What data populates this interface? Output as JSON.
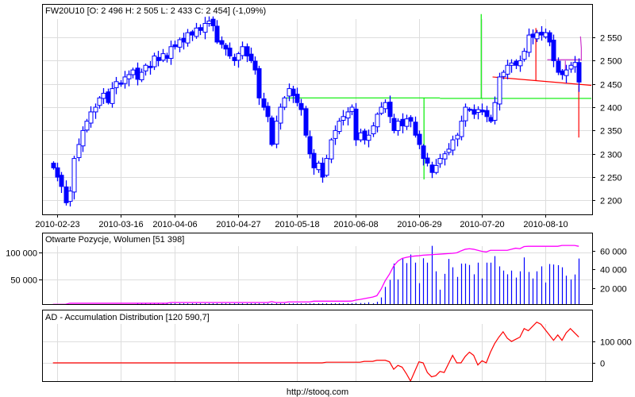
{
  "footer": "http://stooq.com",
  "colors": {
    "candle": "#0000ff",
    "grid": "#dddddd",
    "open_interest": "#ff00ff",
    "volume": "#0000ff",
    "ad": "#ff0000",
    "trend_green": "#00ee00",
    "trend_red": "#ff0000",
    "trend_magenta": "#cc33cc"
  },
  "chart_data": [
    {
      "type": "candlestick",
      "title": "FW20U10 [O: 2 496  H: 2 505  L: 2 433  C: 2 454] (-1,09%)",
      "last_ohlc": {
        "open": 2496,
        "high": 2505,
        "low": 2433,
        "close": 2454,
        "change_pct": -1.09
      },
      "x_ticks": [
        {
          "index": 1,
          "label": "2010-02-23"
        },
        {
          "index": 16,
          "label": "2010-03-16"
        },
        {
          "index": 29,
          "label": "2010-04-06"
        },
        {
          "index": 44,
          "label": "2010-04-27"
        },
        {
          "index": 58,
          "label": "2010-05-18"
        },
        {
          "index": 72,
          "label": "2010-06-08"
        },
        {
          "index": 87,
          "label": "2010-06-29"
        },
        {
          "index": 102,
          "label": "2010-07-20"
        },
        {
          "index": 117,
          "label": "2010-08-10"
        }
      ],
      "y_ticks": [
        {
          "v": 2200,
          "label": "2 200"
        },
        {
          "v": 2250,
          "label": "2 250"
        },
        {
          "v": 2300,
          "label": "2 300"
        },
        {
          "v": 2350,
          "label": "2 350"
        },
        {
          "v": 2400,
          "label": "2 400"
        },
        {
          "v": 2450,
          "label": "2 450"
        },
        {
          "v": 2500,
          "label": "2 500"
        },
        {
          "v": 2550,
          "label": "2 550"
        }
      ],
      "ylim": [
        2170,
        2620
      ],
      "close": [
        2270,
        2250,
        2230,
        2195,
        2220,
        2290,
        2320,
        2350,
        2370,
        2390,
        2400,
        2420,
        2430,
        2410,
        2440,
        2455,
        2450,
        2465,
        2470,
        2480,
        2460,
        2475,
        2490,
        2485,
        2510,
        2500,
        2515,
        2505,
        2530,
        2530,
        2545,
        2540,
        2560,
        2555,
        2570,
        2565,
        2580,
        2585,
        2575,
        2540,
        2535,
        2525,
        2510,
        2500,
        2515,
        2530,
        2510,
        2500,
        2480,
        2420,
        2400,
        2380,
        2320,
        2370,
        2400,
        2420,
        2440,
        2425,
        2410,
        2395,
        2340,
        2300,
        2270,
        2280,
        2250,
        2290,
        2330,
        2350,
        2370,
        2380,
        2390,
        2400,
        2330,
        2345,
        2330,
        2340,
        2360,
        2385,
        2400,
        2410,
        2380,
        2350,
        2370,
        2360,
        2375,
        2370,
        2340,
        2320,
        2290,
        2280,
        2260,
        2275,
        2290,
        2300,
        2310,
        2330,
        2340,
        2370,
        2400,
        2395,
        2385,
        2395,
        2390,
        2380,
        2370,
        2410,
        2465,
        2475,
        2490,
        2495,
        2490,
        2500,
        2520,
        2555,
        2550,
        2560,
        2555,
        2560,
        2540,
        2500,
        2475,
        2470,
        2480,
        2490,
        2496,
        2454
      ],
      "trend_lines": [
        {
          "color": "trend_green",
          "points": [
            [
              55.5,
              2420
            ],
            [
              92,
              2420
            ]
          ]
        },
        {
          "color": "trend_green",
          "points": [
            [
              92,
              2419
            ],
            [
              128,
              2419
            ]
          ]
        },
        {
          "color": "trend_green",
          "points": [
            [
              88.2,
              2420
            ],
            [
              88.2,
              2245
            ]
          ]
        },
        {
          "color": "trend_green",
          "points": [
            [
              101.8,
              2419
            ],
            [
              101.8,
              2600
            ]
          ]
        },
        {
          "color": "trend_red",
          "points": [
            [
              104.5,
              2465
            ],
            [
              128,
              2447
            ]
          ]
        },
        {
          "color": "trend_red",
          "points": [
            [
              114.8,
              2457
            ],
            [
              114.8,
              2570
            ]
          ]
        },
        {
          "color": "trend_red",
          "points": [
            [
              125,
              2447
            ],
            [
              125,
              2335
            ]
          ]
        },
        {
          "color": "trend_magenta",
          "points": [
            [
              117.5,
              2502
            ],
            [
              125.5,
              2502
            ]
          ]
        },
        {
          "color": "trend_magenta",
          "points": [
            [
              121.8,
              2500
            ],
            [
              121.8,
              2470
            ]
          ]
        },
        {
          "color": "trend_magenta",
          "points": [
            [
              125.6,
              2500
            ],
            [
              125.6,
              2527
            ],
            [
              125.4,
              2552
            ]
          ]
        }
      ]
    },
    {
      "type": "bar+line",
      "title": "Otwarte Pozycje, Wolumen [51 398]",
      "left_axis": {
        "ticks": [
          {
            "v": 50000,
            "label": "50 000"
          },
          {
            "v": 100000,
            "label": "100 000"
          }
        ]
      },
      "right_axis": {
        "ticks": [
          {
            "v": 20000,
            "label": "20 000"
          },
          {
            "v": 40000,
            "label": "40 000"
          },
          {
            "v": 60000,
            "label": "60 000"
          }
        ]
      },
      "series": [
        {
          "name": "Otwarte Pozycje",
          "axis": "left",
          "type": "line",
          "values": [
            4000,
            4000,
            4000,
            4000,
            6000,
            6000,
            6000,
            6000,
            6000,
            6000,
            6000,
            6000,
            6000,
            6000,
            6000,
            6000,
            6000,
            6000,
            6000,
            6000,
            6000,
            6000,
            6000,
            6000,
            6000,
            6000,
            6000,
            6000,
            7400,
            7400,
            7400,
            7400,
            7400,
            7400,
            7400,
            7400,
            7400,
            7400,
            7400,
            7400,
            7400,
            7400,
            7400,
            7400,
            7400,
            7400,
            7400,
            7400,
            7400,
            7400,
            7400,
            7400,
            9000,
            7400,
            7400,
            7400,
            8500,
            8500,
            8500,
            8500,
            8500,
            8500,
            9800,
            9800,
            9800,
            9800,
            9800,
            9800,
            9800,
            9800,
            9800,
            10000,
            12000,
            13000,
            14500,
            16000,
            17500,
            20000,
            32000,
            48000,
            60000,
            75000,
            84000,
            89000,
            91000,
            92500,
            93500,
            94000,
            95000,
            95500,
            96000,
            96500,
            97000,
            97500,
            98000,
            98500,
            99500,
            103000,
            106000,
            107000,
            106000,
            104000,
            102000,
            101000,
            104000,
            104000,
            104000,
            104000,
            104000,
            106000,
            108000,
            107000,
            111000,
            111500,
            111500,
            111500,
            111500,
            111500,
            111500,
            111500,
            111500,
            113000,
            113000,
            113000,
            113000,
            111500
          ]
        },
        {
          "name": "Wolumen",
          "axis": "right",
          "type": "bar",
          "values": [
            0,
            0,
            0,
            0,
            0,
            0,
            0,
            0,
            0,
            0,
            0,
            0,
            0,
            0,
            0,
            0,
            0,
            0,
            0,
            0,
            1200,
            900,
            1500,
            1100,
            1800,
            1300,
            1000,
            1600,
            1400,
            2000,
            1200,
            1700,
            1500,
            1100,
            1900,
            1300,
            1600,
            1000,
            1400,
            2200,
            1500,
            1200,
            1800,
            1600,
            1300,
            2000,
            1700,
            1400,
            2100,
            1500,
            1800,
            1200,
            1600,
            2300,
            1900,
            1400,
            2000,
            1700,
            2500,
            1600,
            2200,
            1800,
            2600,
            2000,
            1700,
            2400,
            2100,
            2800,
            2300,
            1900,
            3000,
            2600,
            3700,
            3700,
            3700,
            4500,
            2800,
            5000,
            9700,
            21000,
            28500,
            46000,
            29000,
            52000,
            46500,
            55700,
            47000,
            25000,
            51700,
            47000,
            65000,
            37700,
            18000,
            35000,
            51000,
            42000,
            31700,
            46000,
            46000,
            44500,
            34500,
            47000,
            30000,
            47000,
            47000,
            54000,
            43000,
            38500,
            34500,
            38500,
            31000,
            37700,
            52600,
            37000,
            30000,
            37700,
            43000,
            25700,
            45500,
            45000,
            44300,
            42000,
            33000,
            29000,
            34300,
            51398
          ]
        }
      ]
    },
    {
      "type": "line",
      "title": "AD - Accumulation Distribution [120 590,7]",
      "y_ticks": [
        {
          "v": 0,
          "label": "0"
        },
        {
          "v": 100000,
          "label": "100 000"
        }
      ],
      "values": [
        0,
        0,
        0,
        0,
        0,
        0,
        0,
        0,
        0,
        0,
        0,
        0,
        0,
        0,
        0,
        0,
        0,
        0,
        0,
        0,
        0,
        0,
        0,
        0,
        0,
        0,
        0,
        0,
        0,
        0,
        0,
        0,
        0,
        0,
        0,
        0,
        0,
        0,
        0,
        0,
        0,
        0,
        0,
        0,
        0,
        0,
        0,
        0,
        0,
        0,
        0,
        0,
        0,
        0,
        0,
        0,
        0,
        0,
        0,
        0,
        0,
        0,
        0,
        0,
        0,
        3000,
        3000,
        3000,
        3000,
        3000,
        3000,
        3000,
        3000,
        3000,
        7000,
        7000,
        7000,
        12000,
        12000,
        12000,
        5000,
        -30000,
        -12000,
        -20000,
        -50000,
        -85000,
        -40000,
        5000,
        0,
        -45000,
        -65000,
        -60000,
        -40000,
        -45000,
        -5000,
        35000,
        0,
        0,
        30000,
        50000,
        35000,
        -10000,
        10000,
        0,
        50000,
        90000,
        120000,
        145000,
        115000,
        100000,
        110000,
        120000,
        160000,
        150000,
        170000,
        190000,
        180000,
        155000,
        130000,
        105000,
        130000,
        105000,
        140000,
        160000,
        140000,
        120591
      ]
    }
  ]
}
